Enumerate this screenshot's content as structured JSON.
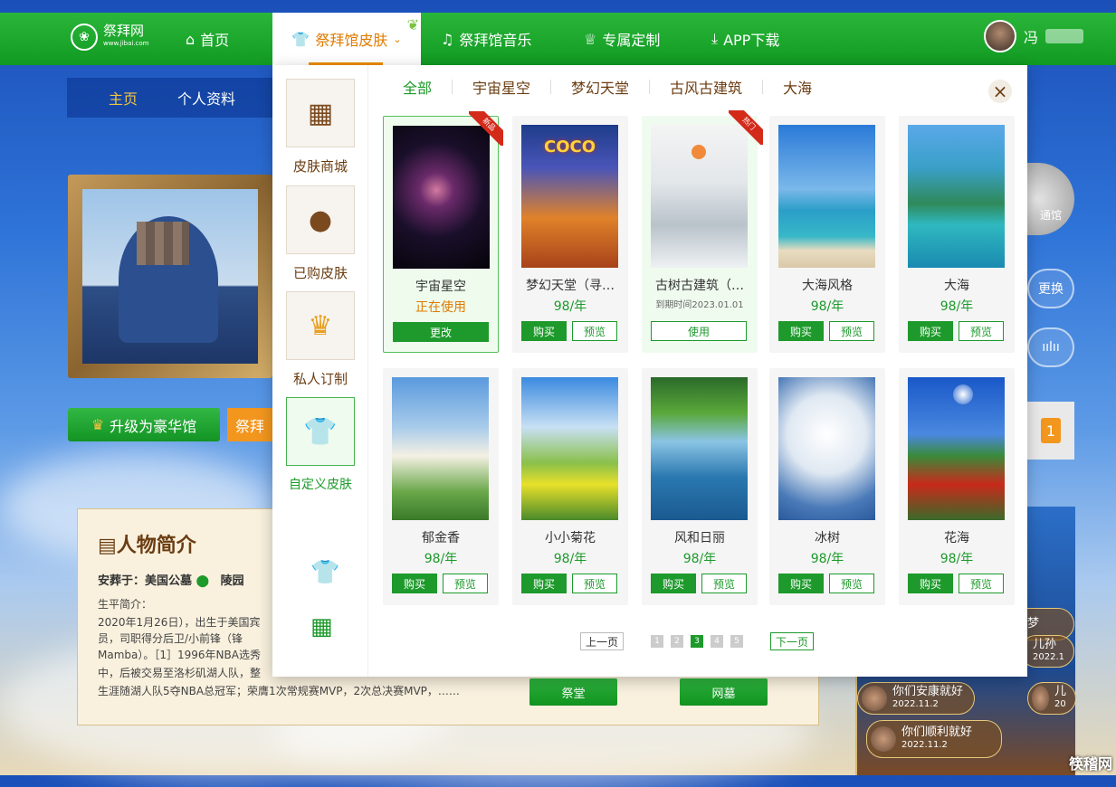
{
  "nav": {
    "logo_text": "祭拜网",
    "logo_sub": "www.jibai.com",
    "home": "首页",
    "skin": "祭拜馆皮肤",
    "music": "祭拜馆音乐",
    "custom": "专属定制",
    "app": "APP下载",
    "user_name": "冯"
  },
  "bg": {
    "subnav_home": "主页",
    "subnav_profile": "个人资料",
    "upgrade": "升级为豪华馆",
    "jibai": "祭拜",
    "intro_title": "人物简介",
    "buried": "安葬于：美国公墓",
    "lingyuan": "陵园",
    "line2": "生平简介：",
    "line3": "2020年1月26日），出生于美国宾",
    "line4": "员，司职得分后卫/小前锋（锋",
    "line5": "Mamba）。［1］1996年NBA选秀",
    "line6": "中，后被交易至洛杉矶湖人队，整",
    "line7": "生涯随湖人队5夺NBA总冠军；荣膺1次常规赛MVP，2次总决赛MVP，……",
    "btn_tang": "祭堂",
    "btn_wangmu": "网墓",
    "change": "更换",
    "badge_num": "1",
    "medal_text": "通馆",
    "msg_partial1": "是梦",
    "msg_partial2": "儿孙",
    "msg_partial2_date": "2022.1",
    "msg1": "你们安康就好",
    "msg1_date": "2022.11.2",
    "msg2": "你们顺利就好",
    "msg2_date": "2022.11.2",
    "msg_partial3": "儿",
    "msg_partial3_date": "20",
    "watermark": "筷稽网"
  },
  "modal": {
    "side": [
      "皮肤商城",
      "已购皮肤",
      "私人订制",
      "自定义皮肤"
    ],
    "tabs": [
      "全部",
      "宇宙星空",
      "梦幻天堂",
      "古风古建筑",
      "大海"
    ],
    "close": "×",
    "cards": [
      {
        "name": "宇宙星空",
        "price": "正在使用",
        "btn": "更改",
        "ribbon": "新品"
      },
      {
        "name": "梦幻天堂（寻…",
        "price": "98/年",
        "buy": "购买",
        "preview": "预览"
      },
      {
        "name": "古树古建筑（…",
        "price": "到期时间2023.01.01",
        "btn": "使用",
        "ribbon": "热门"
      },
      {
        "name": "大海风格",
        "price": "98/年",
        "buy": "购买",
        "preview": "预览"
      },
      {
        "name": "大海",
        "price": "98/年",
        "buy": "购买",
        "preview": "预览"
      },
      {
        "name": "郁金香",
        "price": "98/年",
        "buy": "购买",
        "preview": "预览"
      },
      {
        "name": "小小菊花",
        "price": "98/年",
        "buy": "购买",
        "preview": "预览"
      },
      {
        "name": "风和日丽",
        "price": "98/年",
        "buy": "购买",
        "preview": "预览"
      },
      {
        "name": "冰树",
        "price": "98/年",
        "buy": "购买",
        "preview": "预览"
      },
      {
        "name": "花海",
        "price": "98/年",
        "buy": "购买",
        "preview": "预览"
      }
    ],
    "coco_text": "COCO",
    "pager": {
      "prev": "上一页",
      "pages": [
        "1",
        "2",
        "3",
        "4",
        "5"
      ],
      "current": "3",
      "next": "下一页"
    }
  },
  "colors": {
    "brand_green": "#1d9a2b",
    "accent_orange": "#e07b00"
  }
}
